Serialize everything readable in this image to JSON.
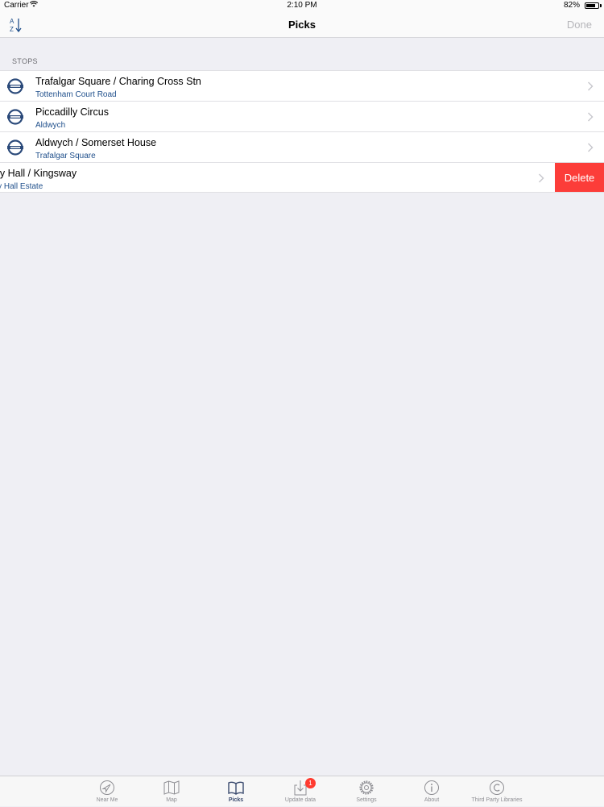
{
  "status_bar": {
    "carrier": "Carrier",
    "time": "2:10 PM",
    "battery": "82%",
    "battery_level": 0.82
  },
  "nav": {
    "title": "Picks",
    "done_label": "Done",
    "sort_icon": "sort-az-icon"
  },
  "section": {
    "header": "STOPS"
  },
  "stops": [
    {
      "title": "Trafalgar Square / Charing Cross Stn",
      "subtitle": "Tottenham Court Road"
    },
    {
      "title": "Piccadilly Circus",
      "subtitle": "Aldwych"
    },
    {
      "title": "Aldwych / Somerset House",
      "subtitle": "Trafalgar Square"
    },
    {
      "title": "ney Hall / Kingsway",
      "subtitle": "ney Hall Estate"
    }
  ],
  "swipe_action": {
    "label": "Delete",
    "color": "#fc3d39"
  },
  "tabs": [
    {
      "label": "Near Me",
      "icon": "location-arrow-icon"
    },
    {
      "label": "Map",
      "icon": "map-icon"
    },
    {
      "label": "Picks",
      "icon": "book-icon"
    },
    {
      "label": "Update data",
      "icon": "download-icon",
      "badge": "1"
    },
    {
      "label": "Settings",
      "icon": "gear-icon"
    },
    {
      "label": "About",
      "icon": "info-icon"
    },
    {
      "label": "Third Party Libraries",
      "icon": "copyright-icon"
    }
  ],
  "colors": {
    "accent": "#1f4f8b",
    "background": "#efeff4"
  }
}
